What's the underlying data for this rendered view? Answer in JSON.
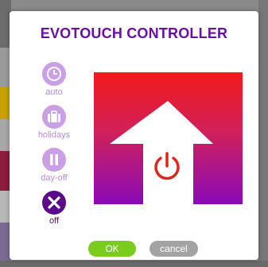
{
  "dialog": {
    "title": "EVOTOUCH CONTROLLER"
  },
  "modes": [
    {
      "id": "auto",
      "label": "auto",
      "icon": "clock-icon",
      "active": false
    },
    {
      "id": "holidays",
      "label": "holidays",
      "icon": "suitcase-icon",
      "active": false
    },
    {
      "id": "day-off",
      "label": "day-off",
      "icon": "pause-icon",
      "active": false
    },
    {
      "id": "off",
      "label": "off",
      "icon": "close-icon",
      "active": true
    }
  ],
  "status": {
    "icon": "power-icon",
    "colors": {
      "gradient_top": "#f21a1a",
      "gradient_bottom": "#8a0ab8",
      "power": "#e0261c"
    }
  },
  "footer": {
    "ok_label": "OK",
    "cancel_label": "cancel"
  },
  "colors": {
    "title": "#6a0fa3",
    "mode_inactive": "#c9a0e6",
    "mode_active": "#5a0a8a",
    "ok": "#7acc1f",
    "cancel": "#a3a3a3"
  }
}
